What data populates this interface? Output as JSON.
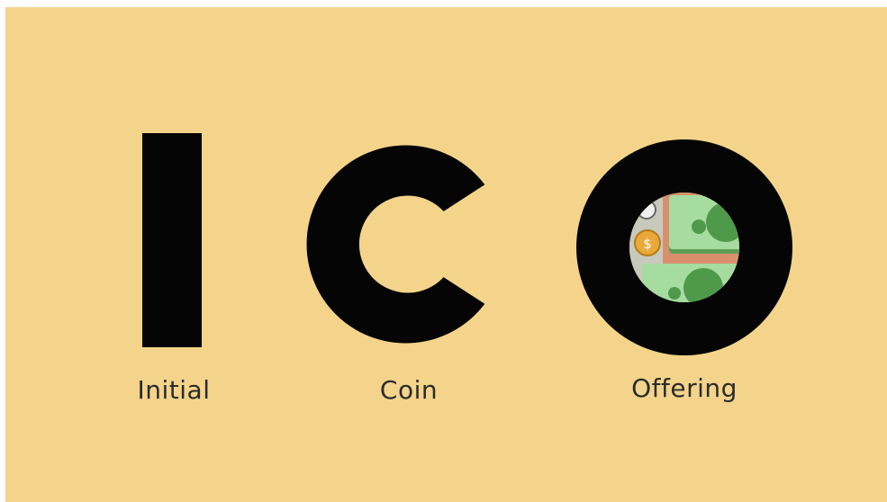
{
  "background_color": "#f4d48a",
  "letter_color": "#050505",
  "acronym": {
    "letters": [
      "I",
      "C",
      "O"
    ]
  },
  "words": {
    "first": "Initial",
    "second": "Coin",
    "third": "Offering"
  },
  "illustration": {
    "subject": "money-icon",
    "colors": {
      "banknote": "#8fd08a",
      "banknote_dark": "#4f9a4a",
      "coin": "#e9a93a",
      "backdrop": "#d8906e"
    }
  }
}
